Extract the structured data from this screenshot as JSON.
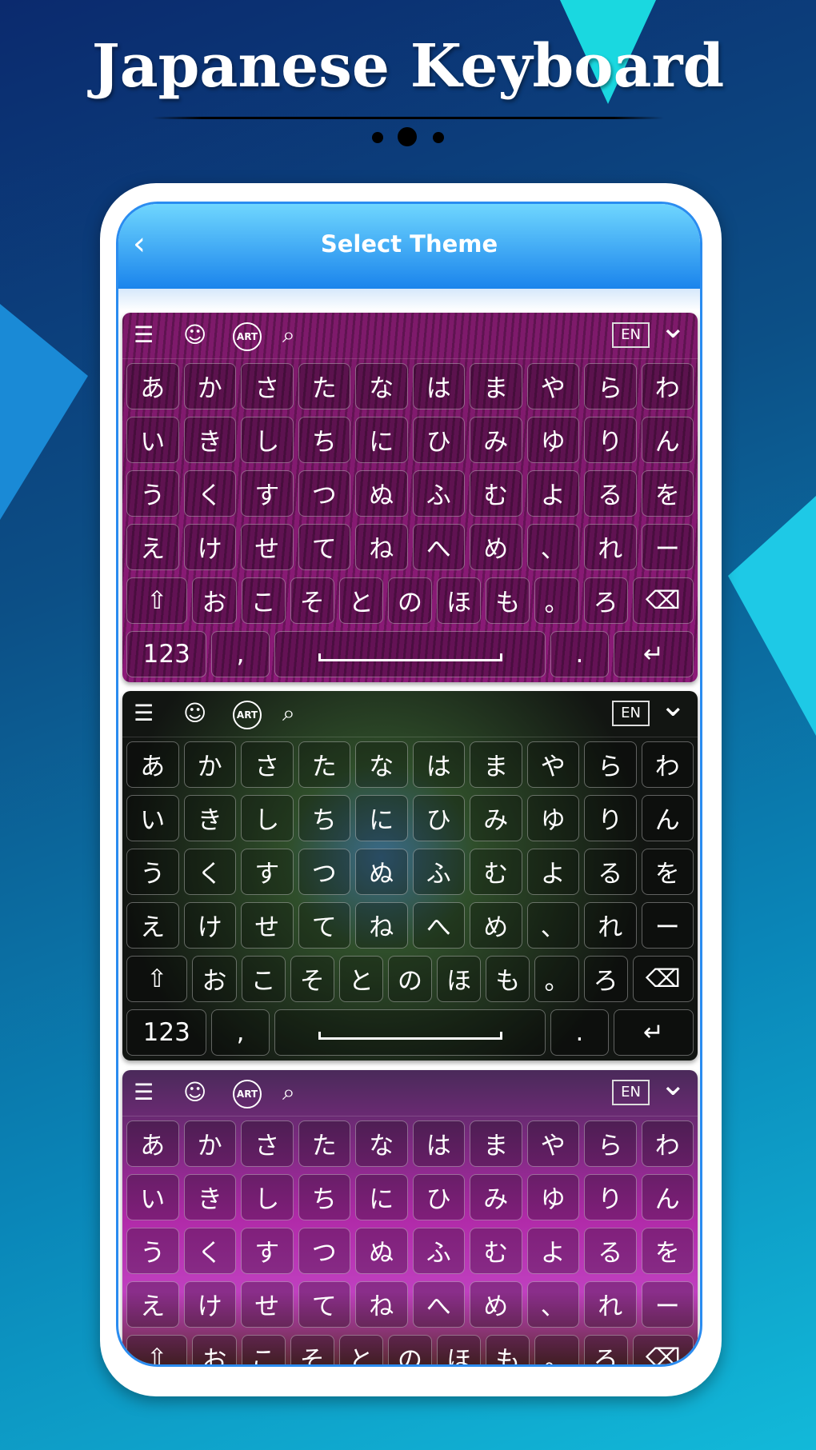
{
  "promo_title": "Japanese Keyboard",
  "header": {
    "back_icon": "chevron-left-icon",
    "title": "Select Theme"
  },
  "toolbar": {
    "icons": [
      "menu-icon",
      "smiley-icon",
      "art-icon",
      "search-icon"
    ],
    "art_label": "ART",
    "lang": "EN",
    "collapse_icon": "chevron-down-icon"
  },
  "rows": [
    [
      "あ",
      "か",
      "さ",
      "た",
      "な",
      "は",
      "ま",
      "や",
      "ら",
      "わ"
    ],
    [
      "い",
      "き",
      "し",
      "ち",
      "に",
      "ひ",
      "み",
      "ゆ",
      "り",
      "ん"
    ],
    [
      "う",
      "く",
      "す",
      "つ",
      "ぬ",
      "ふ",
      "む",
      "よ",
      "る",
      "を"
    ],
    [
      "え",
      "け",
      "せ",
      "て",
      "ね",
      "へ",
      "め",
      "、",
      "れ",
      "ー"
    ],
    [
      "⇧",
      "お",
      "こ",
      "そ",
      "と",
      "の",
      "ほ",
      "も",
      "。",
      "ろ",
      "⌫"
    ]
  ],
  "bottom_row": [
    "123",
    ",",
    "␣",
    ".",
    "↵"
  ],
  "themes": [
    {
      "name": "purple-texture",
      "bg": "#7a1466"
    },
    {
      "name": "dark-nature",
      "bg": "#1d2a1e"
    },
    {
      "name": "aurora",
      "bg": "#6a1f6e"
    }
  ]
}
